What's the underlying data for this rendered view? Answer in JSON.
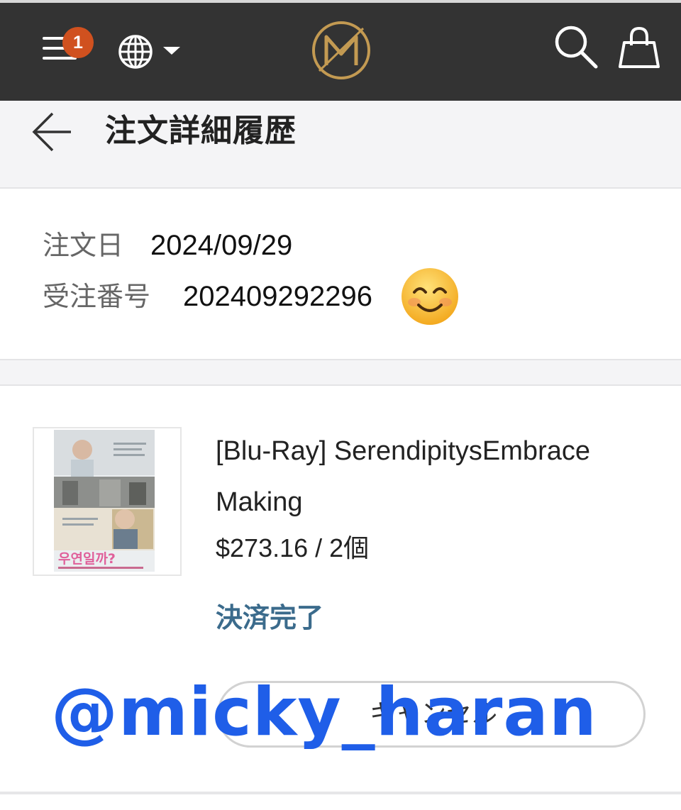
{
  "nav": {
    "menu_icon": "hamburger-menu-icon",
    "badge_count": "1",
    "language_icon": "globe-icon",
    "logo_icon": "m-monogram-logo",
    "logo_letter": "M",
    "search_icon": "search-icon",
    "bag_icon": "shopping-bag-icon"
  },
  "header": {
    "back_icon": "back-arrow-icon",
    "title": "注文詳細履歴"
  },
  "order": {
    "date_label": "注文日",
    "date_value": "2024/09/29",
    "number_label": "受注番号",
    "number_value": "202409292296",
    "emoji": "smiling-face-emoji"
  },
  "product": {
    "name": "[Blu-Ray] SerendipitysEmbrace Making",
    "price": "$273.16 / 2個",
    "status": "決済完了",
    "thumbnail_title": "우연일까?"
  },
  "actions": {
    "cancel_label": "キャンセル"
  },
  "overlay": {
    "watermark": "@micky_haran"
  },
  "colors": {
    "navbar": "#333333",
    "badge": "#d0511f",
    "logo_gold": "#c39a52",
    "status_blue": "#3b6b8c",
    "watermark_blue": "#1f5ee8",
    "band_gray": "#f4f4f6"
  }
}
